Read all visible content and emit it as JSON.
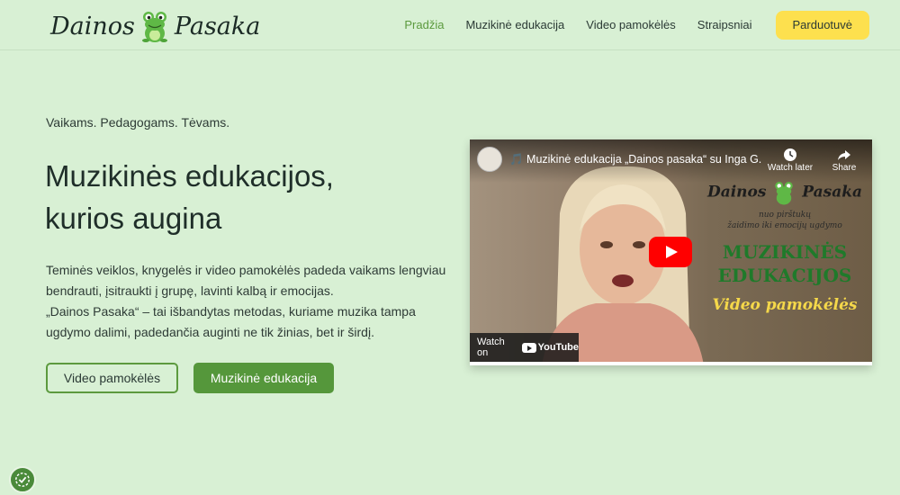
{
  "header": {
    "logo": {
      "text_left": "Dainos",
      "text_right": "Pasaka",
      "icon": "frog-icon"
    },
    "nav": [
      {
        "label": "Pradžia",
        "active": true
      },
      {
        "label": "Muzikinė edukacija",
        "active": false
      },
      {
        "label": "Video pamokėlės",
        "active": false
      },
      {
        "label": "Straipsniai",
        "active": false
      }
    ],
    "shop_label": "Parduotuvė"
  },
  "hero": {
    "tagline": "Vaikams. Pedagogams. Tėvams.",
    "title_line1": "Muzikinės edukacijos,",
    "title_line2": "kurios augina",
    "text_line1": "Teminės veiklos, knygelės ir video pamokėlės padeda vaikams lengviau",
    "text_line2": "bendrauti, įsitraukti į grupę, lavinti kalbą ir emocijas.",
    "text_line3": "„Dainos Pasaka“ – tai išbandytas metodas, kuriame muzika tampa",
    "text_line4": "ugdymo dalimi, padedančia auginti ne tik žinias, bet ir širdį.",
    "button_outline": "Video pamokėlės",
    "button_solid": "Muzikinė edukacija"
  },
  "video": {
    "title": "🎵 Muzikinė edukacija „Dainos pasaka“ su Inga G...",
    "watch_later": "Watch later",
    "share": "Share",
    "watch_on": "Watch on",
    "youtube": "YouTube",
    "overlay": {
      "brand_left": "Dainos",
      "brand_right": "Pasaka",
      "sub_line1": "nuo pirštukų",
      "sub_line2": "žaidimo iki emocijų ugdymo",
      "main_line1": "MUZIKINĖS",
      "main_line2": "EDUKACIJOS",
      "video_label": "Video pamokėlės"
    }
  },
  "colors": {
    "background": "#d8f0d4",
    "accent_green": "#55973b",
    "shop_yellow": "#fde04e",
    "youtube_red": "#ff0000"
  }
}
